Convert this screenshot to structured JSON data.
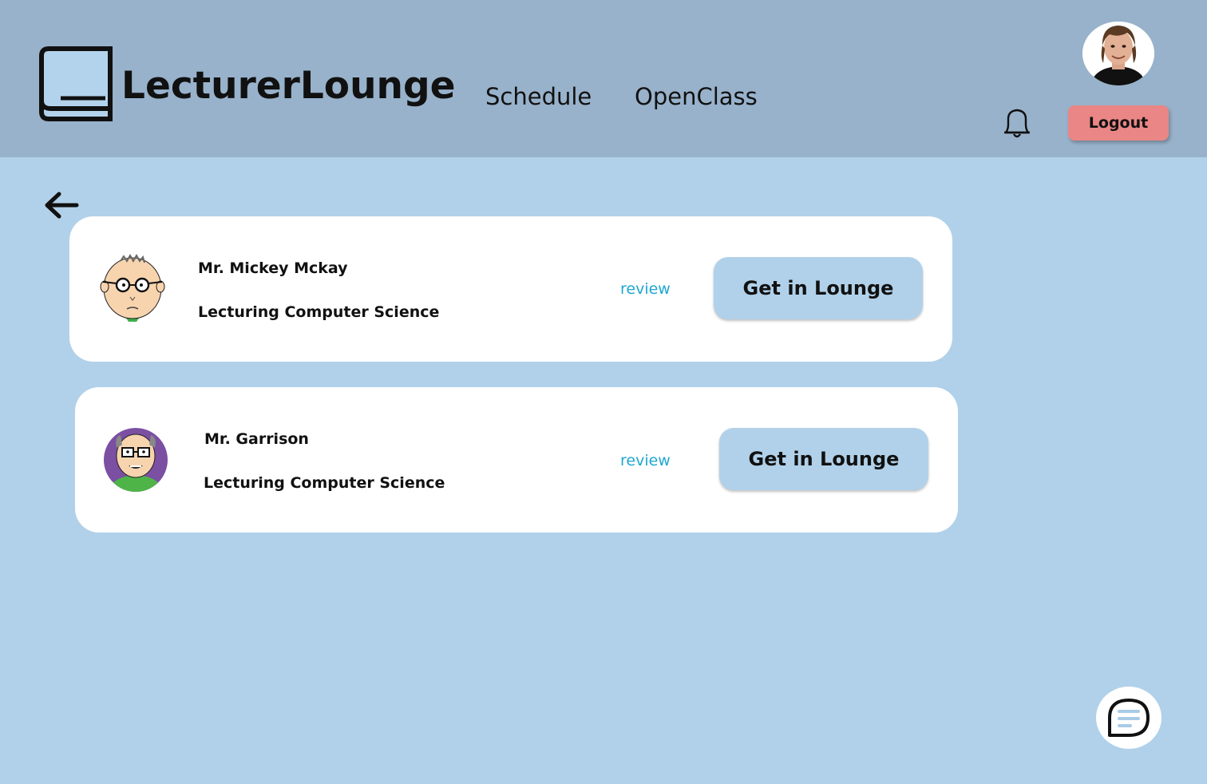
{
  "header": {
    "brand": "LecturerLounge",
    "nav": [
      {
        "label": "Schedule"
      },
      {
        "label": "OpenClass"
      }
    ],
    "logout_label": "Logout"
  },
  "lecturers": [
    {
      "name": "Mr. Mickey Mckay",
      "subject": "Lecturing Computer Science",
      "review_label": "review",
      "button_label": "Get in Lounge"
    },
    {
      "name": "Mr. Garrison",
      "subject": "Lecturing Computer Science",
      "review_label": "review",
      "button_label": "Get in Lounge"
    }
  ],
  "colors": {
    "header_bg": "#98b2cb",
    "page_bg": "#b1d1ea",
    "logout_bg": "#ea8685",
    "review_link": "#1fa7d0"
  },
  "icons": [
    "book-logo-icon",
    "bell-icon",
    "back-arrow-icon",
    "chat-icon"
  ]
}
